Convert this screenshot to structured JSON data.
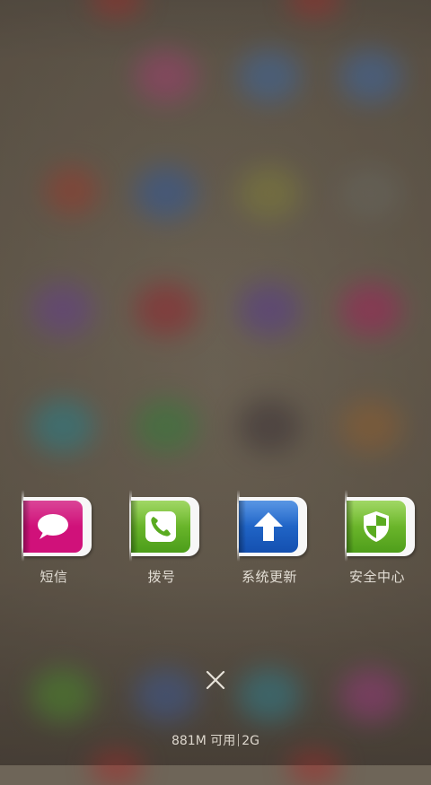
{
  "recent_apps": [
    {
      "label": "短信",
      "icon": "message-bubble-icon",
      "color": "#d0117a"
    },
    {
      "label": "拨号",
      "icon": "phone-handset-icon",
      "color": "#5fb323"
    },
    {
      "label": "系统更新",
      "icon": "up-arrow-icon",
      "color": "#1a5fc8"
    },
    {
      "label": "安全中心",
      "icon": "shield-icon",
      "color": "#6cb52a"
    }
  ],
  "close_icon": "close-icon",
  "memory": {
    "available": "881M 可用",
    "ram_total": "2G"
  }
}
